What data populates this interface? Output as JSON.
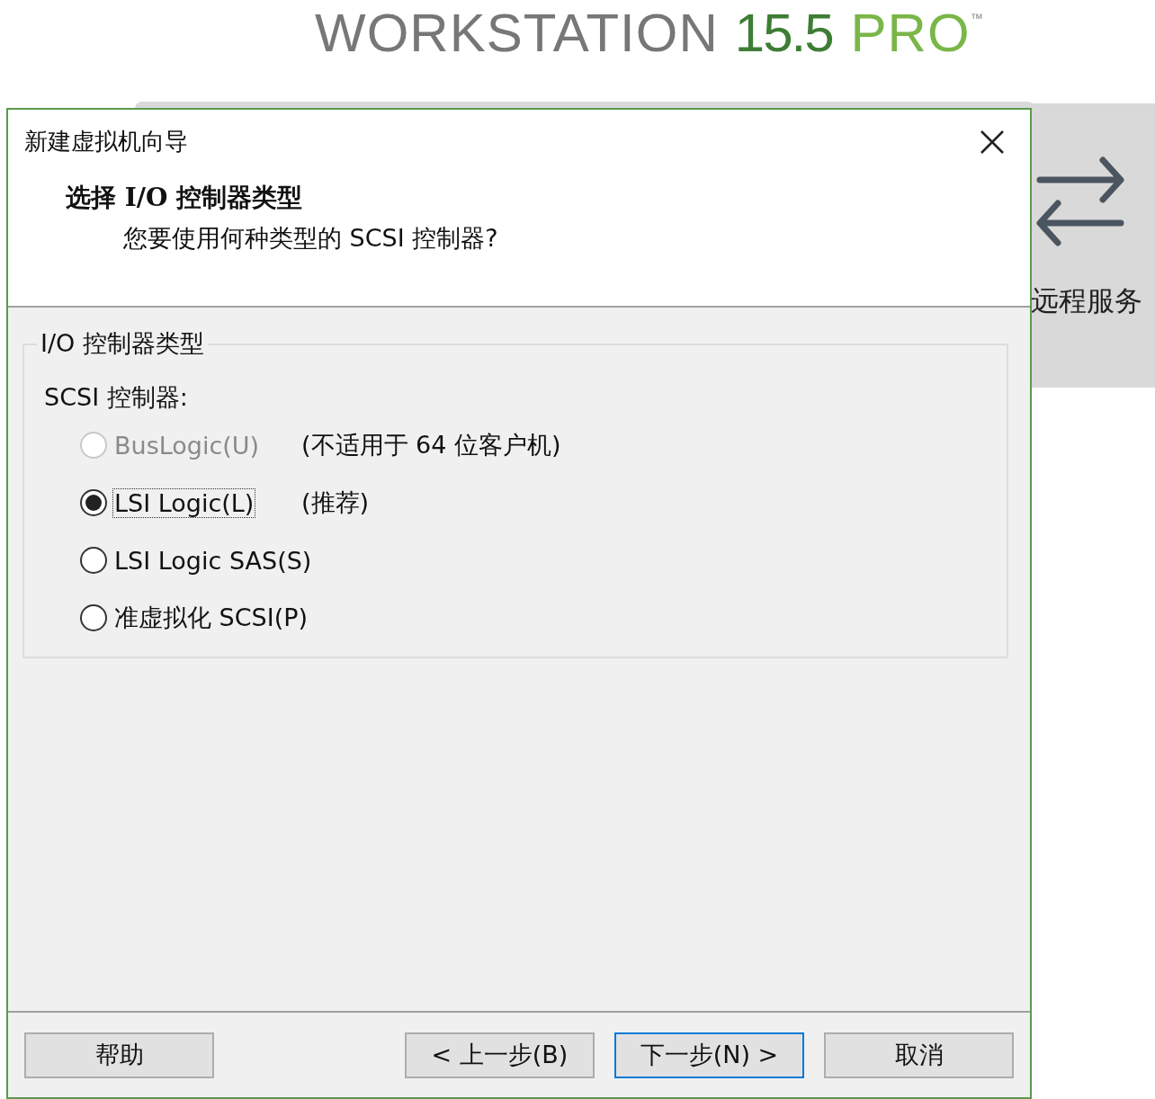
{
  "logo": {
    "product": "WORKSTATION",
    "version": "15.5",
    "edition": "PRO",
    "mark": "™"
  },
  "background_panel": {
    "label": "远程服务"
  },
  "dialog": {
    "title": "新建虚拟机向导",
    "heading": "选择 I/O 控制器类型",
    "subheading": "您要使用何种类型的 SCSI 控制器?",
    "group": {
      "legend": "I/O 控制器类型",
      "label": "SCSI 控制器:",
      "options": [
        {
          "label": "BusLogic(U)",
          "note": "(不适用于 64 位客户机)",
          "selected": false,
          "disabled": true,
          "focused": false
        },
        {
          "label": "LSI Logic(L)",
          "note": "(推荐)",
          "selected": true,
          "disabled": false,
          "focused": true
        },
        {
          "label": "LSI Logic SAS(S)",
          "selected": false,
          "disabled": false,
          "focused": false
        },
        {
          "label": "准虚拟化 SCSI(P)",
          "selected": false,
          "disabled": false,
          "focused": false
        }
      ]
    },
    "buttons": [
      {
        "label": "帮助",
        "default": false
      },
      {
        "label": "< 上一步(B)",
        "default": false
      },
      {
        "label": "下一步(N) >",
        "default": true
      },
      {
        "label": "取消",
        "default": false
      }
    ]
  }
}
